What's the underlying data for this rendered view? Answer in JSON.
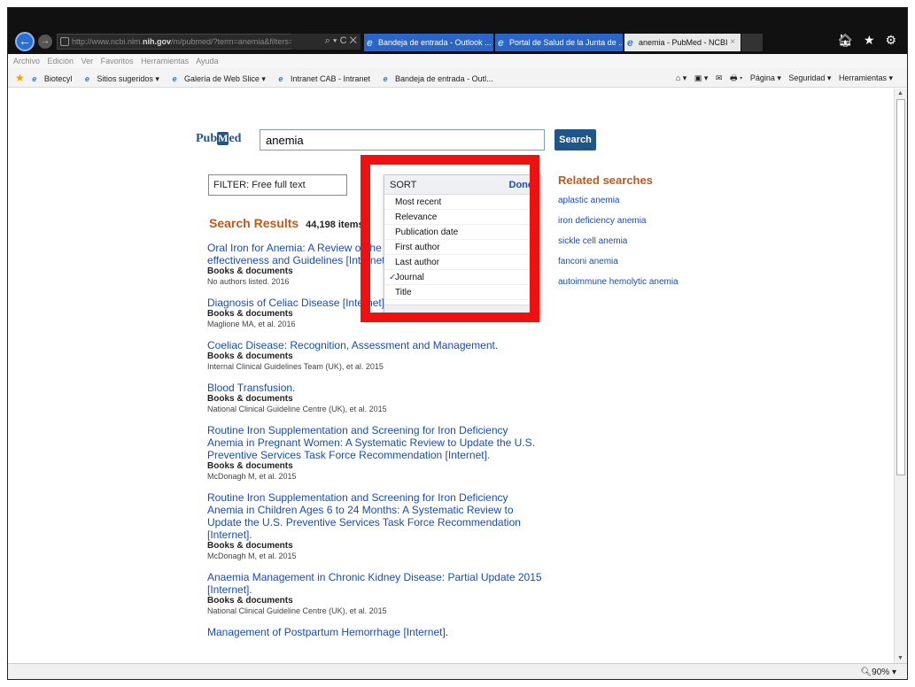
{
  "browser": {
    "address_plain": "http://www.ncbi.nlm.",
    "address_bold": "nih.gov",
    "address_rest": "/m/pubmed/?term=anemia&filters=ffrft&sort",
    "address_tools": "⌕ ▾ C ✕",
    "tabs": [
      {
        "label": "Bandeja de entrada - Outlook ..."
      },
      {
        "label": "Portal de Salud de la Junta de ..."
      },
      {
        "label": "anemia - PubMed - NCBI"
      }
    ],
    "tab_close": "×",
    "top_icons": "🏠︎ ★ ⚙︎",
    "menu": [
      "Archivo",
      "Edición",
      "Ver",
      "Favoritos",
      "Herramientas",
      "Ayuda"
    ],
    "favorites": [
      "Biotecyl",
      "Sitios sugeridos ▾",
      "Galería de Web Slice ▾",
      "Intranet CAB - Intranet",
      "Bandeja de entrada - Outl..."
    ],
    "command_bar": [
      "⌂ ▾",
      "▣ ▾",
      "✉",
      "🖶︎ ▾",
      "Página ▾",
      "Seguridad ▾",
      "Herramientas ▾"
    ],
    "zoom": "🔍︎90%  ▾"
  },
  "page": {
    "logo_pub": "Pub",
    "logo_m": "M",
    "logo_ed": "ed",
    "search_value": "anemia",
    "search_button": "Search",
    "filter_label": "FILTER:",
    "filter_value": "Free full text",
    "results_heading": "Search Results",
    "results_count": "44,198 items",
    "results": [
      {
        "title": "Oral Iron for Anemia: A Review of the Clinical Effectiveness, Cost-effectiveness and Guidelines [Internet].",
        "type": "Books & documents",
        "meta": "No authors listed. 2016"
      },
      {
        "title": "Diagnosis of Celiac Disease [Internet].",
        "type": "Books & documents",
        "meta": "Maglione MA, et al. 2016"
      },
      {
        "title": "Coeliac Disease: Recognition, Assessment and Management.",
        "type": "Books & documents",
        "meta": "Internal Clinical Guidelines Team (UK), et al. 2015"
      },
      {
        "title": "Blood Transfusion.",
        "type": "Books & documents",
        "meta": "National Clinical Guideline Centre (UK), et al. 2015"
      },
      {
        "title": "Routine Iron Supplementation and Screening for Iron Deficiency Anemia in Pregnant Women: A Systematic Review to Update the U.S. Preventive Services Task Force Recommendation [Internet].",
        "type": "Books & documents",
        "meta": "McDonagh M, et al. 2015"
      },
      {
        "title": "Routine Iron Supplementation and Screening for Iron Deficiency Anemia in Children Ages 6 to 24 Months: A Systematic Review to Update the U.S. Preventive Services Task Force Recommendation [Internet].",
        "type": "Books & documents",
        "meta": "McDonagh M, et al. 2015"
      },
      {
        "title": "Anaemia Management in Chronic Kidney Disease: Partial Update 2015 [Internet].",
        "type": "Books & documents",
        "meta": "National Clinical Guideline Centre (UK), et al. 2015"
      },
      {
        "title": "Management of Postpartum Hemorrhage [Internet].",
        "type": "",
        "meta": ""
      }
    ],
    "sort": {
      "heading": "SORT",
      "done": "Done",
      "check": "✓",
      "options": [
        "Most recent",
        "Relevance",
        "Publication date",
        "First author",
        "Last author",
        "Journal",
        "Title"
      ],
      "selected": "Journal"
    },
    "related_heading": "Related searches",
    "related": [
      "aplastic anemia",
      "iron deficiency anemia",
      "sickle cell anemia",
      "fanconi anemia",
      "autoimmune hemolytic anemia"
    ]
  },
  "colors": {
    "highlight": "#ee1111",
    "link": "#1a4db3",
    "heading": "#c05a1c",
    "brand": "#20558a"
  }
}
